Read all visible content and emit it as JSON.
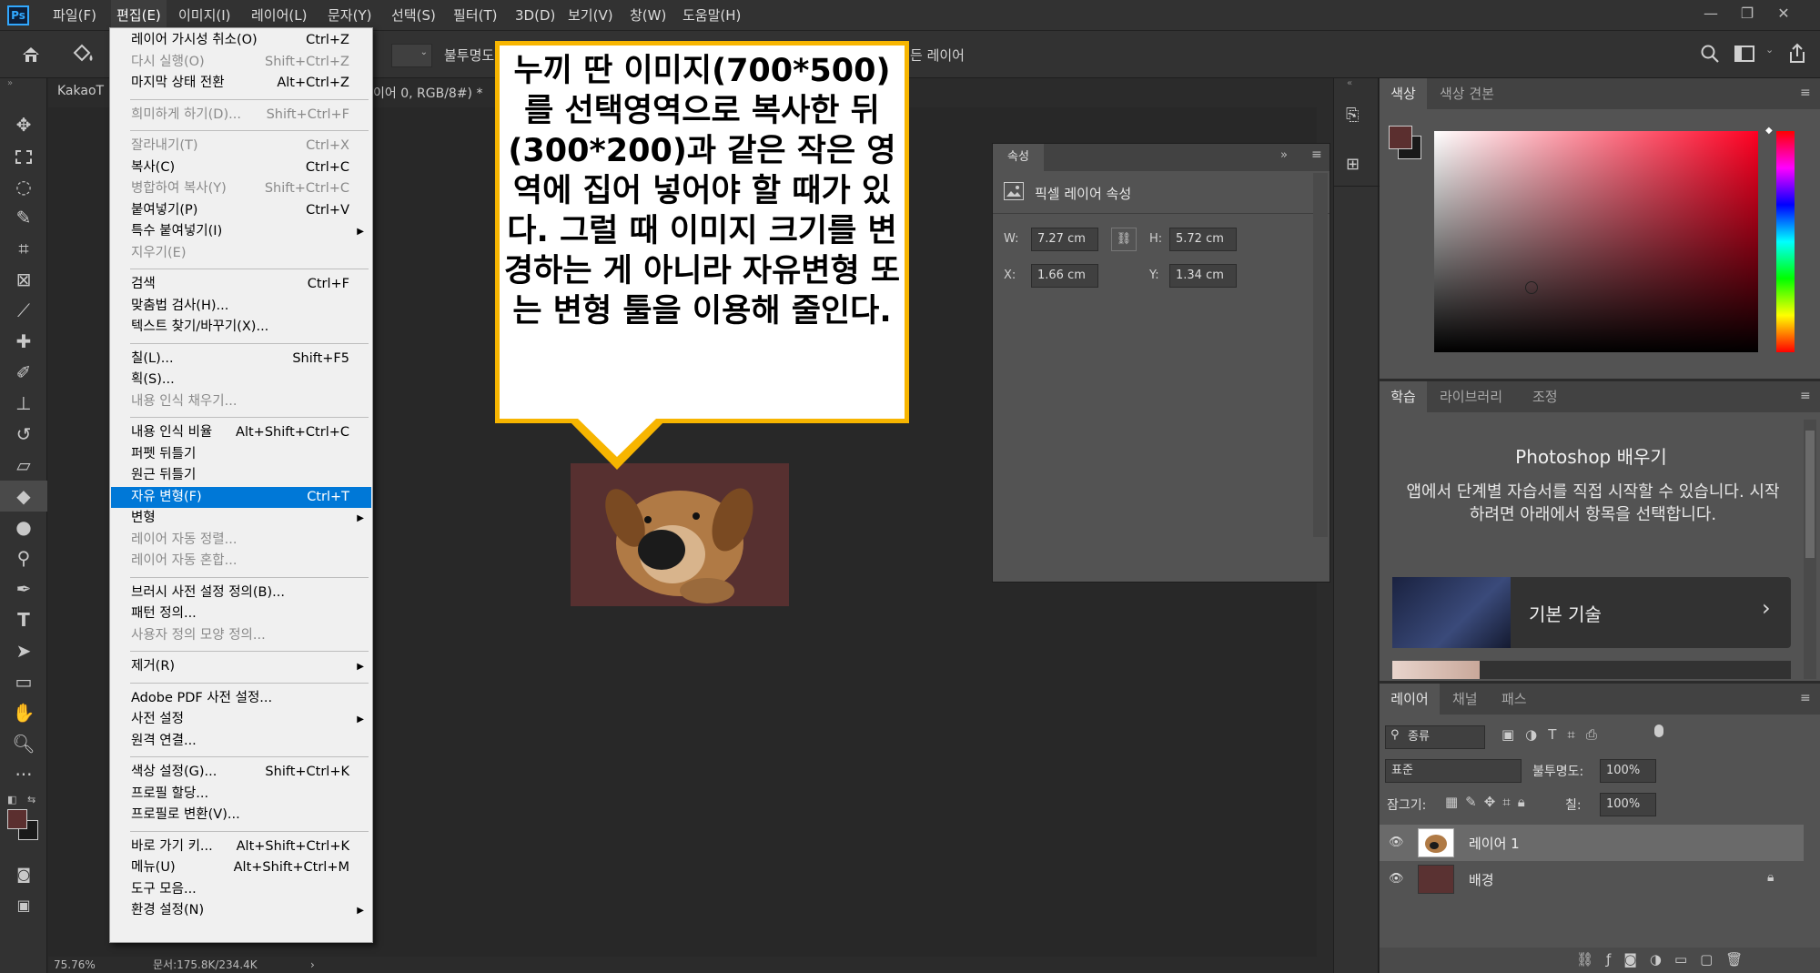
{
  "menubar": {
    "logo": "Ps",
    "items": [
      "파일(F)",
      "편집(E)",
      "이미지(I)",
      "레이어(L)",
      "문자(Y)",
      "선택(S)",
      "필터(T)",
      "3D(D)",
      "보기(V)",
      "창(W)",
      "도움말(H)"
    ],
    "window_buttons": [
      "—",
      "❐",
      "✕"
    ]
  },
  "optbar": {
    "opacity_label": "불투명도",
    "all_layers_text": "든 레이어"
  },
  "document": {
    "tab_title": "KakaoT",
    "tab_info": "이어 0, RGB/8#) *"
  },
  "edit_menu": {
    "items": [
      {
        "label": "레이어 가시성 취소(O)",
        "shortcut": "Ctrl+Z",
        "state": "enabled"
      },
      {
        "label": "다시 실행(O)",
        "shortcut": "Shift+Ctrl+Z",
        "state": "disabled"
      },
      {
        "label": "마지막 상태 전환",
        "shortcut": "Alt+Ctrl+Z",
        "state": "enabled"
      },
      {
        "label": "희미하게 하기(D)...",
        "shortcut": "Shift+Ctrl+F",
        "state": "disabled"
      },
      {
        "label": "잘라내기(T)",
        "shortcut": "Ctrl+X",
        "state": "disabled"
      },
      {
        "label": "복사(C)",
        "shortcut": "Ctrl+C",
        "state": "enabled"
      },
      {
        "label": "병합하여 복사(Y)",
        "shortcut": "Shift+Ctrl+C",
        "state": "disabled"
      },
      {
        "label": "붙여넣기(P)",
        "shortcut": "Ctrl+V",
        "state": "enabled"
      },
      {
        "label": "특수 붙여넣기(I)",
        "shortcut": "",
        "state": "enabled",
        "submenu": true
      },
      {
        "label": "지우기(E)",
        "shortcut": "",
        "state": "disabled"
      },
      {
        "label": "검색",
        "shortcut": "Ctrl+F",
        "state": "enabled"
      },
      {
        "label": "맞춤법 검사(H)...",
        "shortcut": "",
        "state": "enabled"
      },
      {
        "label": "텍스트 찾기/바꾸기(X)...",
        "shortcut": "",
        "state": "enabled"
      },
      {
        "label": "칠(L)...",
        "shortcut": "Shift+F5",
        "state": "enabled"
      },
      {
        "label": "획(S)...",
        "shortcut": "",
        "state": "enabled"
      },
      {
        "label": "내용 인식 채우기...",
        "shortcut": "",
        "state": "disabled"
      },
      {
        "label": "내용 인식 비율",
        "shortcut": "Alt+Shift+Ctrl+C",
        "state": "enabled"
      },
      {
        "label": "퍼펫 뒤틀기",
        "shortcut": "",
        "state": "enabled"
      },
      {
        "label": "원근 뒤틀기",
        "shortcut": "",
        "state": "enabled"
      },
      {
        "label": "자유 변형(F)",
        "shortcut": "Ctrl+T",
        "state": "selected"
      },
      {
        "label": "변형",
        "shortcut": "",
        "state": "enabled",
        "submenu": true
      },
      {
        "label": "레이어 자동 정렬...",
        "shortcut": "",
        "state": "disabled"
      },
      {
        "label": "레이어 자동 혼합...",
        "shortcut": "",
        "state": "disabled"
      },
      {
        "label": "브러시 사전 설정 정의(B)...",
        "shortcut": "",
        "state": "enabled"
      },
      {
        "label": "패턴 정의...",
        "shortcut": "",
        "state": "enabled"
      },
      {
        "label": "사용자 정의 모양 정의...",
        "shortcut": "",
        "state": "disabled"
      },
      {
        "label": "제거(R)",
        "shortcut": "",
        "state": "enabled",
        "submenu": true
      },
      {
        "label": "Adobe PDF 사전 설정...",
        "shortcut": "",
        "state": "enabled"
      },
      {
        "label": "사전 설정",
        "shortcut": "",
        "state": "enabled",
        "submenu": true
      },
      {
        "label": "원격 연결...",
        "shortcut": "",
        "state": "enabled"
      },
      {
        "label": "색상 설정(G)...",
        "shortcut": "Shift+Ctrl+K",
        "state": "enabled"
      },
      {
        "label": "프로필 할당...",
        "shortcut": "",
        "state": "enabled"
      },
      {
        "label": "프로필로 변환(V)...",
        "shortcut": "",
        "state": "enabled"
      },
      {
        "label": "바로 가기 키...",
        "shortcut": "Alt+Shift+Ctrl+K",
        "state": "enabled"
      },
      {
        "label": "메뉴(U)",
        "shortcut": "Alt+Shift+Ctrl+M",
        "state": "enabled"
      },
      {
        "label": "도구 모음...",
        "shortcut": "",
        "state": "enabled"
      },
      {
        "label": "환경 설정(N)",
        "shortcut": "",
        "state": "enabled",
        "submenu": true
      }
    ]
  },
  "callout": {
    "text": "누끼 딴 이미지(700*500)를 선택영역으로 복사한 뒤 (300*200)과 같은 작은 영역에 집어 넣어야 할 때가 있다. 그럴 때 이미지 크기를 변경하는 게 아니라 자유변형 또는 변형 툴을 이용해 줄인다."
  },
  "properties": {
    "tab": "속성",
    "header": "픽셀 레이어 속성",
    "w_label": "W:",
    "w_value": "7.27 cm",
    "h_label": "H:",
    "h_value": "5.72 cm",
    "x_label": "X:",
    "x_value": "1.66 cm",
    "y_label": "Y:",
    "y_value": "1.34 cm"
  },
  "color_panel": {
    "tabs": [
      "색상",
      "색상 견본"
    ],
    "fg_color": "#5b2f2f",
    "bg_color": "#1a1a1a"
  },
  "learn_panel": {
    "tabs": [
      "학습",
      "라이브러리",
      "조정"
    ],
    "title": "Photoshop 배우기",
    "description": "앱에서 단계별 자습서를 직접 시작할 수 있습니다. 시작하려면 아래에서 항목을 선택합니다.",
    "card_label": "기본 기술"
  },
  "layers_panel": {
    "tabs": [
      "레이어",
      "채널",
      "패스"
    ],
    "filter_label": "종류",
    "blend_mode": "표준",
    "opacity_label": "불투명도:",
    "opacity_value": "100%",
    "lock_label": "잠그기:",
    "fill_label": "칠:",
    "fill_value": "100%",
    "layers": [
      {
        "name": "레이어 1",
        "selected": true
      },
      {
        "name": "배경",
        "selected": false
      }
    ]
  },
  "status": {
    "zoom": "75.76%",
    "doc_info": "문서:175.8K/234.4K"
  }
}
